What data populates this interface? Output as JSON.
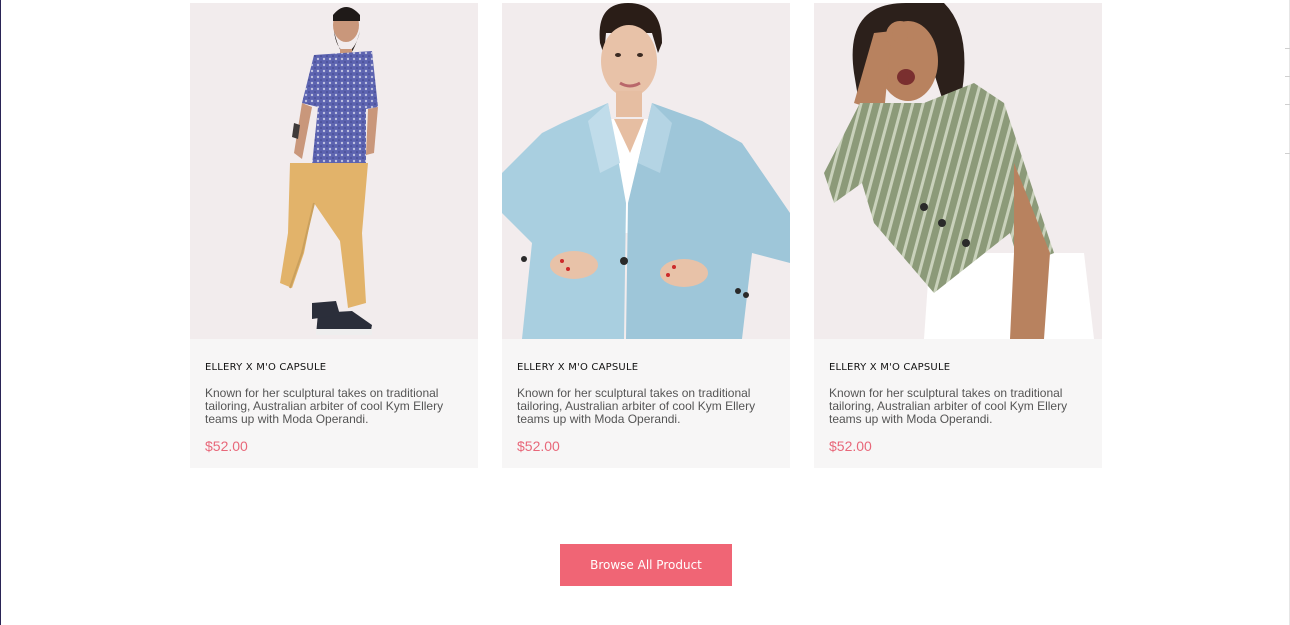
{
  "products": [
    {
      "title": "ELLERY X M'O CAPSULE",
      "description": "Known for her sculptural takes on traditional tailoring, Australian arbiter of cool Kym Ellery teams up with Moda Operandi.",
      "price": "$52.00",
      "image": "man-in-blue-shirt-and-yellow-pants"
    },
    {
      "title": "ELLERY X M'O CAPSULE",
      "description": "Known for her sculptural takes on traditional tailoring, Australian arbiter of cool Kym Ellery teams up with Moda Operandi.",
      "price": "$52.00",
      "image": "woman-in-light-blue-blazer"
    },
    {
      "title": "ELLERY X M'O CAPSULE",
      "description": "Known for her sculptural takes on traditional tailoring, Australian arbiter of cool Kym Ellery teams up with Moda Operandi.",
      "price": "$52.00",
      "image": "woman-in-striped-green-top"
    }
  ],
  "browse_button": {
    "label": "Browse All Product"
  },
  "colors": {
    "accent": "#f06575",
    "price": "#e8687a",
    "card_background": "#f7f6f6",
    "image_background": "#f2eced"
  }
}
